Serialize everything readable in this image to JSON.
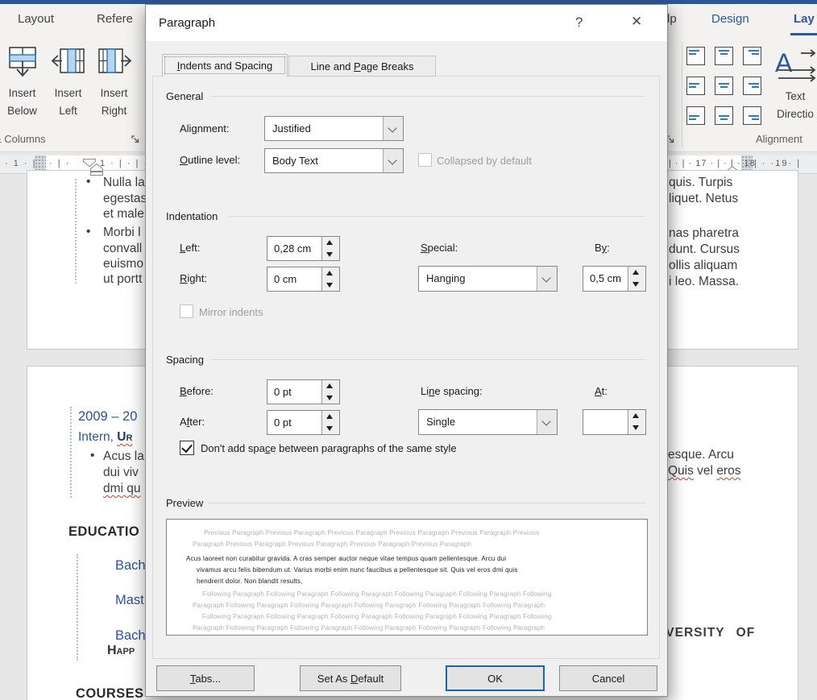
{
  "icons": {
    "bullet": "•"
  },
  "ribbon": {
    "tab_layout": "Layout",
    "tab_references_fragment": "Refere",
    "tab_help_fragment": "lp",
    "tab_design": "Design",
    "tab_table_layout_fragment": "Lay",
    "insert_below": {
      "line1": "Insert",
      "line2": "Below"
    },
    "insert_left": {
      "line1": "Insert",
      "line2": "Left"
    },
    "insert_right": {
      "line1": "Insert",
      "line2": "Right"
    },
    "group_columns_label": "& Columns",
    "group_alignment_label": "Alignment",
    "text_direction": {
      "line1": "Text",
      "line2": "Directio"
    }
  },
  "ruler": {
    "left_outer": "· 1 · |",
    "left_inner1": "· | ·",
    "left_inner2": "1 · | · | ·",
    "right_inner": "| · | · 17 · | · | · 18",
    "right_outer": "| · ·19· |"
  },
  "document": {
    "page1_left_lines": [
      {
        "text": "Nulla la"
      },
      {
        "text": "egestas"
      },
      {
        "text": "et male"
      },
      {
        "text": "Morbi l"
      },
      {
        "text": "convall"
      },
      {
        "text": "euismo"
      },
      {
        "text": "ut portt"
      }
    ],
    "page1_right_lines": [
      "quis. Turpis",
      "liquet. Netus",
      "nas pharetra",
      "dunt. Cursus",
      "ollis aliquam",
      "i leo. Massa."
    ],
    "page2": {
      "date_range": "2009 – 20",
      "intern": "Intern,",
      "intern_smallcaps": "Ur",
      "bullet_line1": "Acus la",
      "bullet_line2": "dui viv",
      "bullet_line3": "dmi qu",
      "education_heading": "EDUCATIO",
      "degree1": "Bach",
      "degree2": "Mast",
      "degree3": "Bach",
      "university_smallcaps": "Happ",
      "courses_heading": "COURSES",
      "right_line1": "esque. Arcu",
      "right_line2a": "Quis",
      "right_line2b": " vel ",
      "right_line2c": "eros",
      "right_university": "IVERSITY OF"
    }
  },
  "dialog": {
    "title": "Paragraph",
    "help_icon": "?",
    "close_icon": "✕",
    "tabs": {
      "indents": {
        "u": "I",
        "post": "ndents and Spacing"
      },
      "breaks": {
        "pre": "Line and ",
        "u": "P",
        "post": "age Breaks"
      }
    },
    "general": {
      "heading": "General",
      "alignment_label": {
        "pre": "Ali",
        "u": "g",
        "post": "nment:"
      },
      "alignment_value": "Justified",
      "outline_label": {
        "u": "O",
        "post": "utline level:"
      },
      "outline_value": "Body Text",
      "collapsed_label": "Collapsed by default"
    },
    "indentation": {
      "heading": "Indentation",
      "left_label": {
        "u": "L",
        "post": "eft:"
      },
      "left_value": "0,28 cm",
      "right_label": {
        "u": "R",
        "post": "ight:"
      },
      "right_value": "0 cm",
      "special_label": {
        "u": "S",
        "post": "pecial:"
      },
      "special_value": "Hanging",
      "by_label": {
        "pre": "B",
        "u": "y",
        "post": ":"
      },
      "by_value": "0,5 cm",
      "mirror_label": "Mirror indents"
    },
    "spacing": {
      "heading": "Spacing",
      "before_label": {
        "u": "B",
        "post": "efore:"
      },
      "before_value": "0 pt",
      "after_label": {
        "pre": "A",
        "u": "f",
        "post": "ter:"
      },
      "after_value": "0 pt",
      "line_spacing_label": {
        "pre": "Li",
        "u": "n",
        "post": "e spacing:"
      },
      "line_spacing_value": "Single",
      "at_value": "",
      "at_label": {
        "u": "A",
        "post": "t:"
      },
      "dont_add_label": {
        "pre": "Don't add spa",
        "u": "c",
        "post": "e between paragraphs of the same style"
      }
    },
    "preview": {
      "heading": "Preview",
      "previous_line1": "Previous Paragraph Previous Paragraph Previous Paragraph Previous Paragraph Previous Paragraph Previous",
      "previous_line2": "Paragraph Previous Paragraph Previous Paragraph Previous Paragraph Previous Paragraph",
      "current_line1": "Acus laoreet non curabitur gravida. A cras semper auctor neque vitae tempus quam pellentesque. Arcu dui",
      "current_line2": "vivamus arcu felis bibendum ut. Varius morbi enim nunc faucibus a pellentesque sit. Quis vel eros dmi quis",
      "current_line3": "hendrerit dolor. Non blandit results,",
      "following_line1": "Following Paragraph Following Paragraph Following Paragraph Following Paragraph Following Paragraph Following",
      "following_line2": "Paragraph Following Paragraph Following Paragraph Following Paragraph Following Paragraph Following Paragraph",
      "following_line3": "Following Paragraph Following Paragraph Following Paragraph Following Paragraph Following Paragraph Following",
      "following_line4": "Paragraph Following Paragraph Following Paragraph Following Paragraph Following Paragraph Following Paragraph"
    },
    "buttons": {
      "tabs": {
        "u": "T",
        "post": "abs..."
      },
      "set_default": {
        "pre": "Set As ",
        "u": "D",
        "post": "efault"
      },
      "ok": "OK",
      "cancel": "Cancel"
    }
  },
  "colors": {
    "accent_blue": "#2b579a",
    "doc_heading_blue": "#2e5496",
    "default_button_border": "#1a66ad",
    "squiggle_red": "#d23b2e"
  }
}
